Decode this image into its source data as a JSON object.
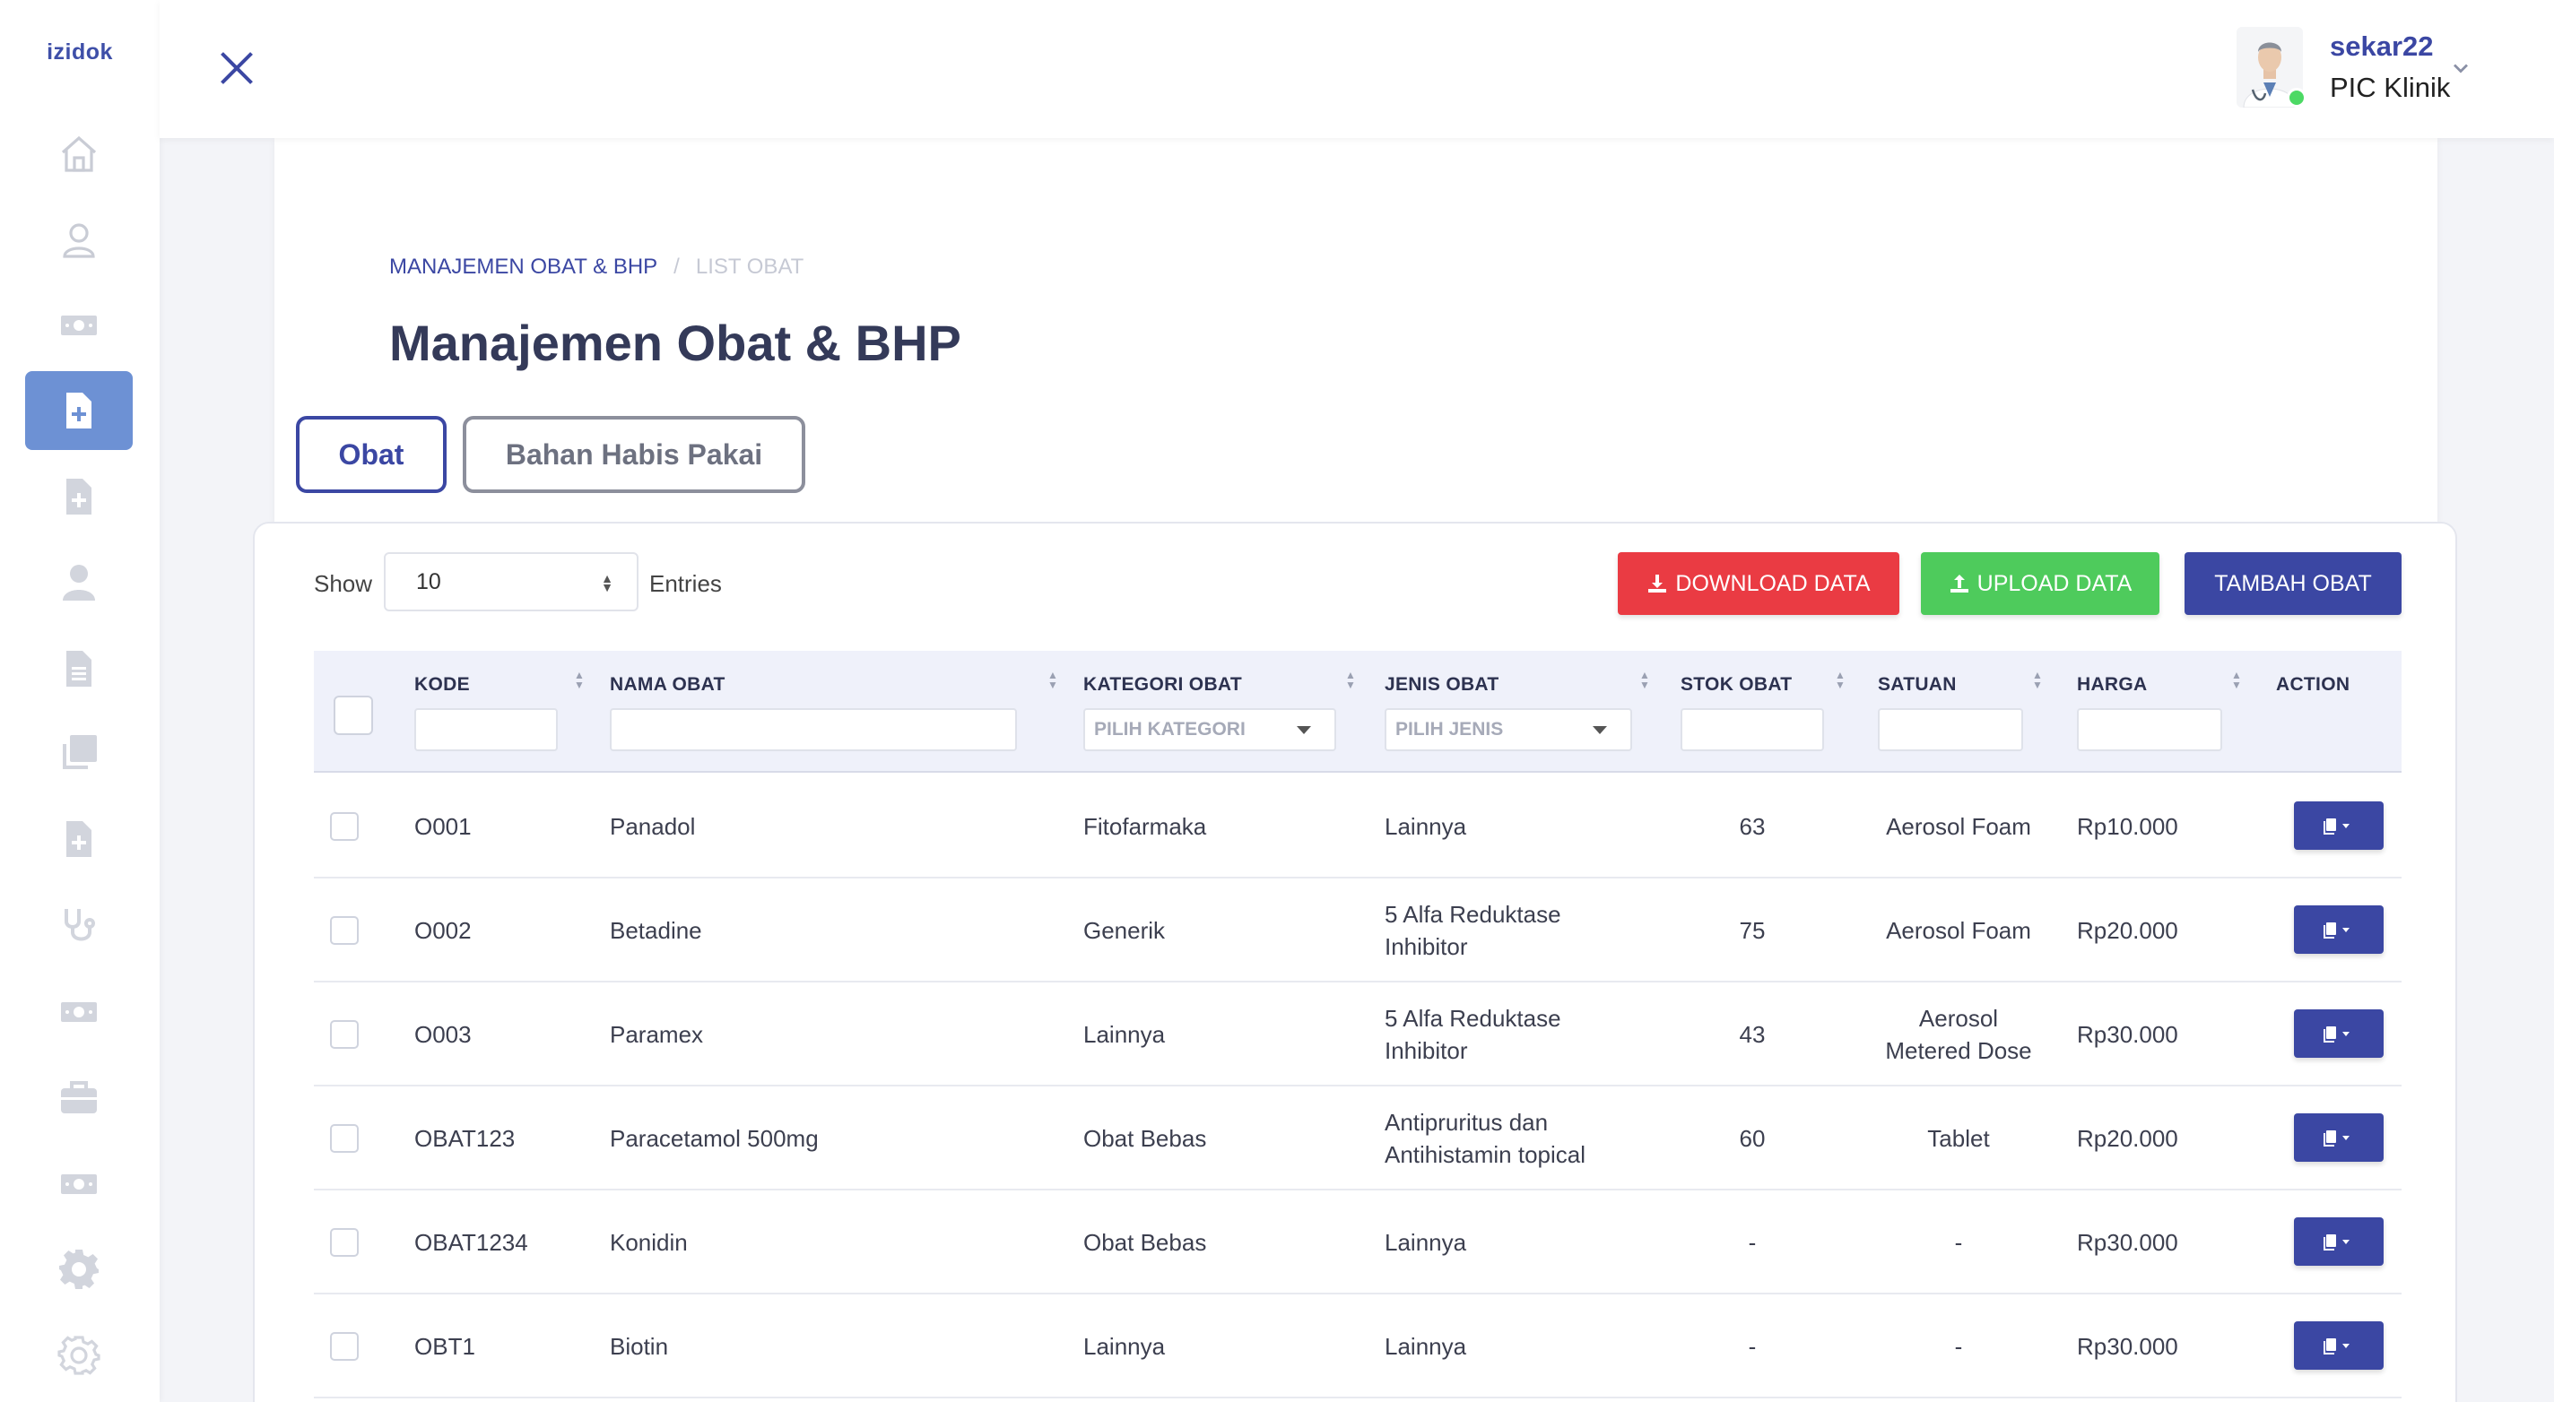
{
  "brand": "izidok",
  "user": {
    "name": "sekar22",
    "role": "PIC Klinik"
  },
  "breadcrumb": {
    "parent": "MANAJEMEN OBAT & BHP",
    "separator": "/",
    "current": "LIST OBAT"
  },
  "page_title": "Manajemen Obat & BHP",
  "tabs": [
    {
      "label": "Obat",
      "active": true
    },
    {
      "label": "Bahan Habis Pakai",
      "active": false
    }
  ],
  "toolbar": {
    "show_label": "Show",
    "entries_value": "10",
    "entries_label": "Entries",
    "download_label": "DOWNLOAD DATA",
    "upload_label": "UPLOAD DATA",
    "add_label": "TAMBAH OBAT"
  },
  "columns": {
    "kode": "KODE",
    "nama": "NAMA OBAT",
    "kategori": "KATEGORI OBAT",
    "jenis": "JENIS OBAT",
    "stok": "STOK OBAT",
    "satuan": "SATUAN",
    "harga": "HARGA",
    "action": "ACTION"
  },
  "filters": {
    "kategori_placeholder": "PILIH KATEGORI",
    "jenis_placeholder": "PILIH JENIS"
  },
  "rows": [
    {
      "kode": "O001",
      "nama": "Panadol",
      "kategori": "Fitofarmaka",
      "jenis": "Lainnya",
      "stok": "63",
      "satuan": "Aerosol Foam",
      "harga": "Rp10.000"
    },
    {
      "kode": "O002",
      "nama": "Betadine",
      "kategori": "Generik",
      "jenis": "5 Alfa Reduktase Inhibitor",
      "stok": "75",
      "satuan": "Aerosol Foam",
      "harga": "Rp20.000"
    },
    {
      "kode": "O003",
      "nama": "Paramex",
      "kategori": "Lainnya",
      "jenis": "5 Alfa Reduktase Inhibitor",
      "stok": "43",
      "satuan": "Aerosol Metered Dose",
      "harga": "Rp30.000"
    },
    {
      "kode": "OBAT123",
      "nama": "Paracetamol 500mg",
      "kategori": "Obat Bebas",
      "jenis": "Antipruritus dan Antihistamin topical",
      "stok": "60",
      "satuan": "Tablet",
      "harga": "Rp20.000"
    },
    {
      "kode": "OBAT1234",
      "nama": "Konidin",
      "kategori": "Obat Bebas",
      "jenis": "Lainnya",
      "stok": "-",
      "satuan": "-",
      "harga": "Rp30.000"
    },
    {
      "kode": "OBT1",
      "nama": "Biotin",
      "kategori": "Lainnya",
      "jenis": "Lainnya",
      "stok": "-",
      "satuan": "-",
      "harga": "Rp30.000"
    }
  ],
  "colors": {
    "primary": "#3b47a3",
    "danger": "#ea3b43",
    "success": "#4ecb5c",
    "sidebar_active": "#6d91d4"
  },
  "sidebar_icons": [
    "home-icon",
    "user-outline-icon",
    "money-icon",
    "file-plus-icon",
    "file-plus-icon",
    "person-icon",
    "document-icon",
    "copy-icon",
    "file-plus-icon",
    "stethoscope-icon",
    "money-icon",
    "briefcase-icon",
    "money-icon",
    "gear-icon",
    "gear-outline-icon"
  ]
}
